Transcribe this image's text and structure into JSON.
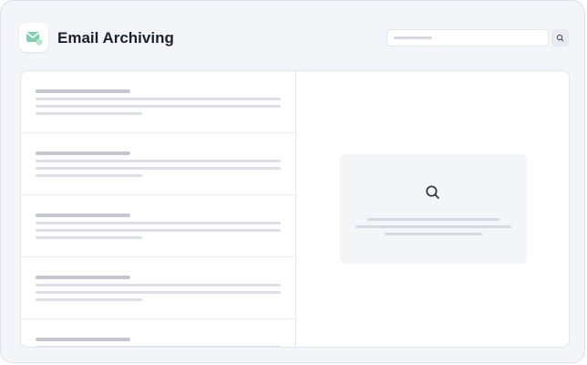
{
  "app": {
    "title": "Email Archiving",
    "icon": "mail-icon",
    "accent_color": "#7ecfb0"
  },
  "header": {
    "search_icon": "search-icon"
  },
  "email_list": {
    "items": [
      {
        "id": 1
      },
      {
        "id": 2
      },
      {
        "id": 3
      },
      {
        "id": 4
      },
      {
        "id": 5
      }
    ]
  },
  "preview": {
    "empty_state_icon": "search-icon"
  }
}
